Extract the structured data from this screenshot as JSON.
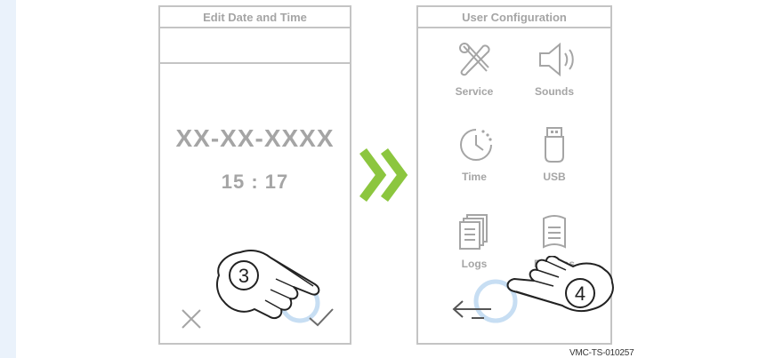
{
  "left_screen": {
    "title": "Edit Date and Time",
    "date_value": "XX-XX-XXXX",
    "time_value": "15 : 17",
    "step_number": "3"
  },
  "right_screen": {
    "title": "User Configuration",
    "items": [
      {
        "label": "Service",
        "icon": "service-tools-icon"
      },
      {
        "label": "Sounds",
        "icon": "speaker-icon"
      },
      {
        "label": "Time",
        "icon": "clock-icon"
      },
      {
        "label": "USB",
        "icon": "usb-icon"
      },
      {
        "label": "Logs",
        "icon": "logs-icon"
      },
      {
        "label": "Recipes",
        "icon": "recipes-icon"
      }
    ],
    "step_number": "4"
  },
  "figure_id": "VMC-TS-010257",
  "colors": {
    "frame": "#c4c4c4",
    "text": "#a5a5a5",
    "arrow": "#8cc63f",
    "tap_ring": "#c7def3",
    "outer_background": "#eaf2fb"
  }
}
